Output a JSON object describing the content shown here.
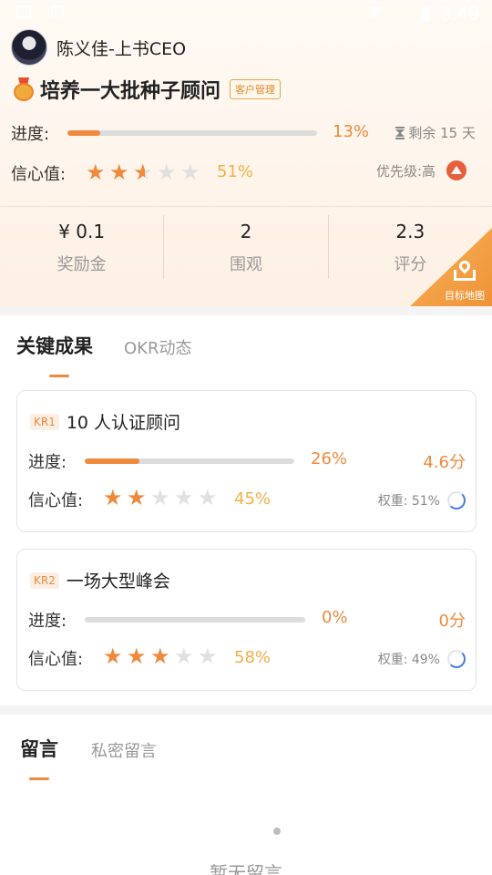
{
  "status_bar": {
    "time": "3:49"
  },
  "owner": {
    "name": "陈义佳-上书CEO"
  },
  "goal": {
    "title": "培养一大批种子顾问",
    "tag": "客户管理",
    "progress_label": "进度:",
    "progress_value": 0.13,
    "progress_text": "13%",
    "remaining_text": "剩余 15 天",
    "confidence_label": "信心值:",
    "confidence_stars": 2.5,
    "confidence_text": "51%",
    "priority_text": "优先级:高"
  },
  "stats": [
    {
      "value": "¥ 0.1",
      "label": "奖励金"
    },
    {
      "value": "2",
      "label": "围观"
    },
    {
      "value": "2.3",
      "label": "评分"
    }
  ],
  "map_button": {
    "label": "目标地图"
  },
  "kr_tabs": {
    "active": "关键成果",
    "inactive": "OKR动态"
  },
  "key_results": [
    {
      "tag": "KR1",
      "title": "10 人认证顾问",
      "progress_label": "进度:",
      "progress_value": 0.26,
      "progress_text": "26%",
      "score": "4.6分",
      "confidence_label": "信心值:",
      "confidence_stars": 2,
      "confidence_text": "45%",
      "weight_text": "权重: 51%"
    },
    {
      "tag": "KR2",
      "title": "一场大型峰会",
      "progress_label": "进度:",
      "progress_value": 0,
      "progress_text": "0%",
      "score": "0分",
      "confidence_label": "信心值:",
      "confidence_stars": 3,
      "confidence_text": "58%",
      "weight_text": "权重: 49%"
    }
  ],
  "comment_tabs": {
    "active": "留言",
    "inactive": "私密留言"
  },
  "comments_empty_text": "暂无留言",
  "colors": {
    "accent": "#ef8a3c",
    "confidence_text": "#f2b045",
    "priority": "#e5603b",
    "weight_ring": "#4a7be0"
  }
}
